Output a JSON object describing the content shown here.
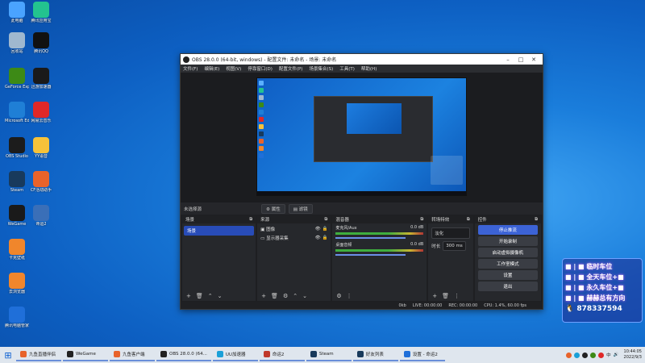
{
  "desktop": {
    "icons": [
      {
        "label": "此电脑",
        "color": "#4aa3ff",
        "icon": "computer-icon"
      },
      {
        "label": "腾讯应用宝",
        "color": "#23c38f",
        "icon": "app-store-icon"
      },
      {
        "label": "回收站",
        "color": "#9fb8cf",
        "icon": "recycle-bin-icon"
      },
      {
        "label": "腾讯QQ",
        "color": "#111111",
        "icon": "qq-icon"
      },
      {
        "label": "GeForce Experience",
        "color": "#3d8a16",
        "icon": "nvidia-icon"
      },
      {
        "label": "迅游加速器",
        "color": "#1a1a1a",
        "icon": "accelerator-icon"
      },
      {
        "label": "Microsoft Edge",
        "color": "#1f7fd6",
        "icon": "edge-icon"
      },
      {
        "label": "网易云音乐",
        "color": "#e02828",
        "icon": "music-icon"
      },
      {
        "label": "OBS Studio",
        "color": "#1c1c1c",
        "icon": "obs-icon"
      },
      {
        "label": "YY语音",
        "color": "#f6c23a",
        "icon": "yy-icon"
      },
      {
        "label": "Steam",
        "color": "#183a5c",
        "icon": "steam-icon"
      },
      {
        "label": "CF活动助手",
        "color": "#e8632b",
        "icon": "cf-icon"
      },
      {
        "label": "WeGame",
        "color": "#1a1a1a",
        "icon": "wegame-icon"
      },
      {
        "label": "命运2",
        "color": "#3a6fb8",
        "icon": "destiny-icon"
      },
      {
        "label": "卡克壁纸",
        "color": "#f0862c",
        "icon": "wallpaper-icon"
      },
      {
        "label": "去浏览器",
        "color": "#f0862c",
        "icon": "browser-icon"
      },
      {
        "label": "腾讯电脑管家",
        "color": "#1f6fd9",
        "icon": "pc-manager-icon"
      }
    ]
  },
  "obs": {
    "title": "OBS 28.0.0 (64-bit, windows) - 配置文件: 未命名 - 场景: 未命名",
    "menu": [
      "文件(F)",
      "编辑(E)",
      "视图(V)",
      "停靠窗口(D)",
      "配置文件(P)",
      "场景集合(S)",
      "工具(T)",
      "帮助(H)"
    ],
    "no_source": "未选择源",
    "props_button": "属性",
    "filters_button": "滤镜",
    "docks": {
      "scenes": {
        "title": "场景",
        "items": [
          "场景"
        ]
      },
      "sources": {
        "title": "来源",
        "items": [
          "图像",
          "显示器采集"
        ]
      },
      "mixer": {
        "title": "混音器",
        "tracks": [
          {
            "name": "麦克风/Aux",
            "db": "0.0 dB"
          },
          {
            "name": "桌面音频",
            "db": "0.0 dB"
          }
        ]
      },
      "transitions": {
        "title": "转场特效",
        "type": "淡化",
        "duration_label": "时长",
        "duration": "300 ms"
      },
      "controls": {
        "title": "控件",
        "buttons": [
          "停止推流",
          "开始录制",
          "启动虚拟摄像机",
          "工作室模式",
          "设置",
          "退出"
        ]
      }
    },
    "status": {
      "live": "LIVE: 00:00:00",
      "rec": "REC: 00:00:00",
      "cpu": "CPU: 1.4%, 60.00 fps",
      "dropped": "0kb"
    }
  },
  "promo": {
    "rows": [
      "■ | ■ 临时车位",
      "■ | ■ 全天车位+■",
      "■ | ■ 永久车位+■",
      "■ | ■ 赫赫总有方向"
    ],
    "number": "878337594"
  },
  "taskbar": {
    "items": [
      {
        "label": "九鱼直播伴侣",
        "color": "#e8632b"
      },
      {
        "label": "WeGame",
        "color": "#222222"
      },
      {
        "label": "九鱼客户端",
        "color": "#e8632b"
      },
      {
        "label": "OBS 28.0.0 (64...",
        "color": "#222222"
      },
      {
        "label": "UU加速器",
        "color": "#1aa0d8"
      },
      {
        "label": "命运2",
        "color": "#c0392b"
      },
      {
        "label": "Steam",
        "color": "#183a5c"
      },
      {
        "label": "好友列表",
        "color": "#183a5c"
      },
      {
        "label": "设置 - 命运2",
        "color": "#1f6fd9"
      }
    ],
    "time": "10:44:05",
    "date": "2022/9/3",
    "ime": "中"
  }
}
